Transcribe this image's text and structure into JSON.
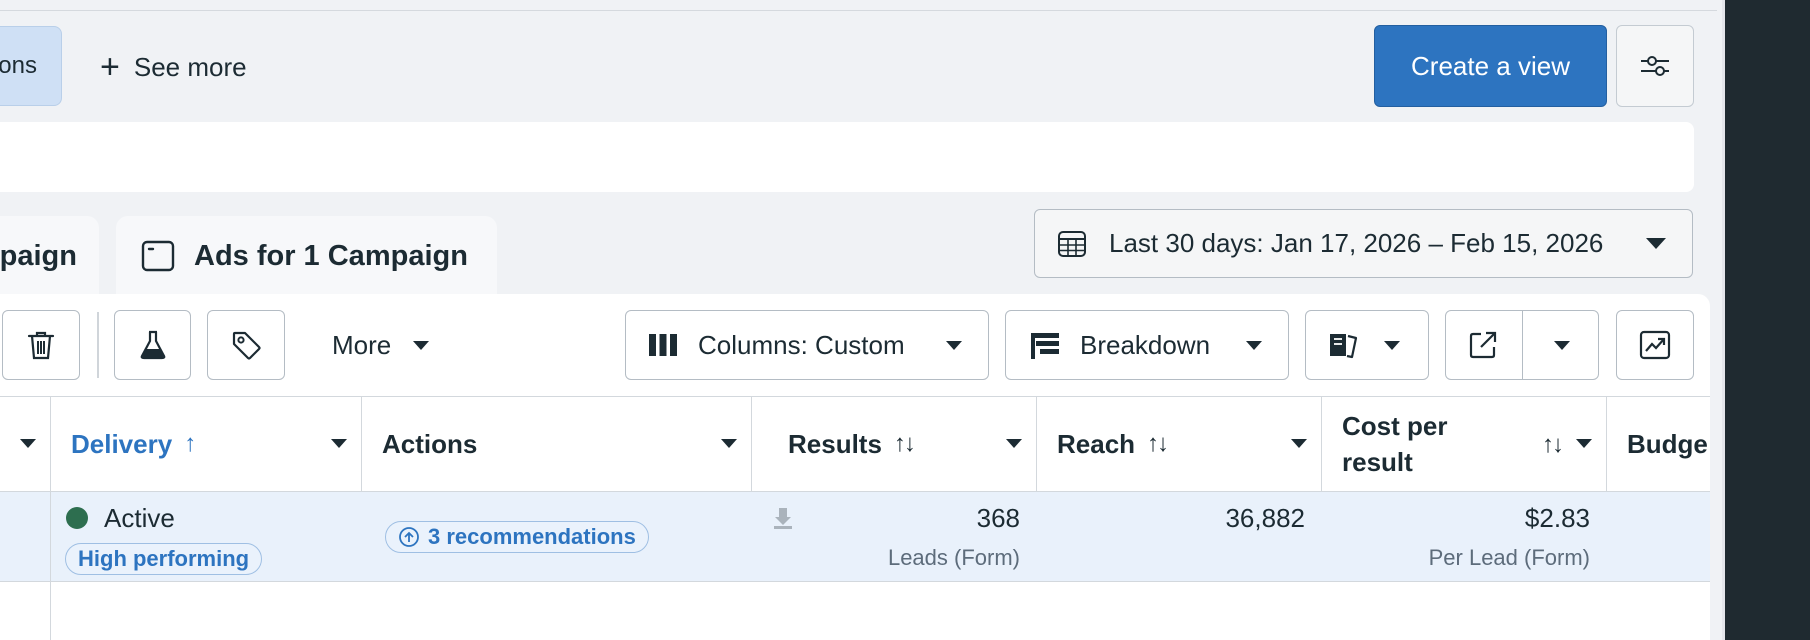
{
  "top": {
    "prev_chip_label": "ons",
    "see_more_label": "See more",
    "create_view_label": "Create a view"
  },
  "tabs": [
    {
      "label": "paign"
    },
    {
      "label": "Ads for 1 Campaign"
    }
  ],
  "date_range": {
    "label": "Last 30 days: Jan 17, 2026 – Feb 15, 2026"
  },
  "toolbar": {
    "more_label": "More",
    "columns_label": "Columns: Custom",
    "breakdown_label": "Breakdown"
  },
  "table": {
    "headers": {
      "delivery": "Delivery",
      "actions": "Actions",
      "results": "Results",
      "reach": "Reach",
      "cost_line1": "Cost per",
      "cost_line2": "result",
      "budget": "Budge"
    },
    "row": {
      "delivery_status": "Active",
      "delivery_badge": "High performing",
      "recommendations": "3 recommendations",
      "results_value": "368",
      "results_sub": "Leads (Form)",
      "reach_value": "36,882",
      "cost_value": "$2.83",
      "cost_sub": "Per Lead (Form)"
    }
  },
  "colors": {
    "accent": "#2d74c0",
    "status_active": "#2d6e4f",
    "row_highlight": "#e9f1fb"
  },
  "icons": [
    "plus-icon",
    "sliders-icon",
    "ad-window-icon",
    "calendar-icon",
    "trash-icon",
    "flask-icon",
    "tag-icon",
    "columns-icon",
    "breakdown-icon",
    "reports-icon",
    "export-icon",
    "chart-icon",
    "download-icon",
    "recommendation-icon"
  ]
}
